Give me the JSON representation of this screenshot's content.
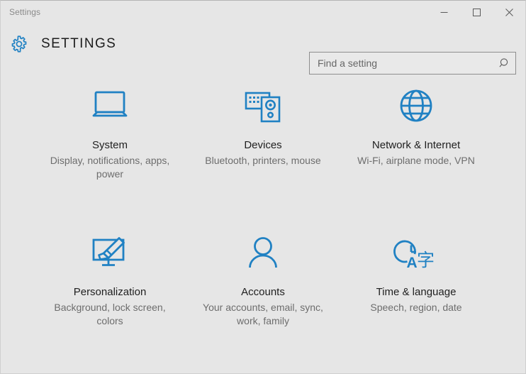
{
  "window": {
    "caption": "Settings",
    "controls": {
      "minimize_label": "Minimize",
      "maximize_label": "Maximize",
      "close_label": "Close"
    }
  },
  "header": {
    "gear_icon": "gear-icon",
    "title": "SETTINGS",
    "search": {
      "placeholder": "Find a setting",
      "value": "",
      "icon": "search-icon"
    }
  },
  "colors": {
    "accent": "#2081c3",
    "window_bg": "#e6e6e6",
    "title_text": "#1f1f1f",
    "desc_text": "#6d6d6d",
    "caption_text": "#8a8a8a"
  },
  "tiles": [
    {
      "icon": "laptop-icon",
      "title": "System",
      "desc": "Display, notifications, apps, power"
    },
    {
      "icon": "keyboard-speaker-icon",
      "title": "Devices",
      "desc": "Bluetooth, printers, mouse"
    },
    {
      "icon": "globe-icon",
      "title": "Network & Internet",
      "desc": "Wi-Fi, airplane mode, VPN"
    },
    {
      "icon": "monitor-paintbrush-icon",
      "title": "Personalization",
      "desc": "Background, lock screen, colors"
    },
    {
      "icon": "person-icon",
      "title": "Accounts",
      "desc": "Your accounts, email, sync, work, family"
    },
    {
      "icon": "clock-language-icon",
      "title": "Time & language",
      "desc": "Speech, region, date"
    }
  ]
}
